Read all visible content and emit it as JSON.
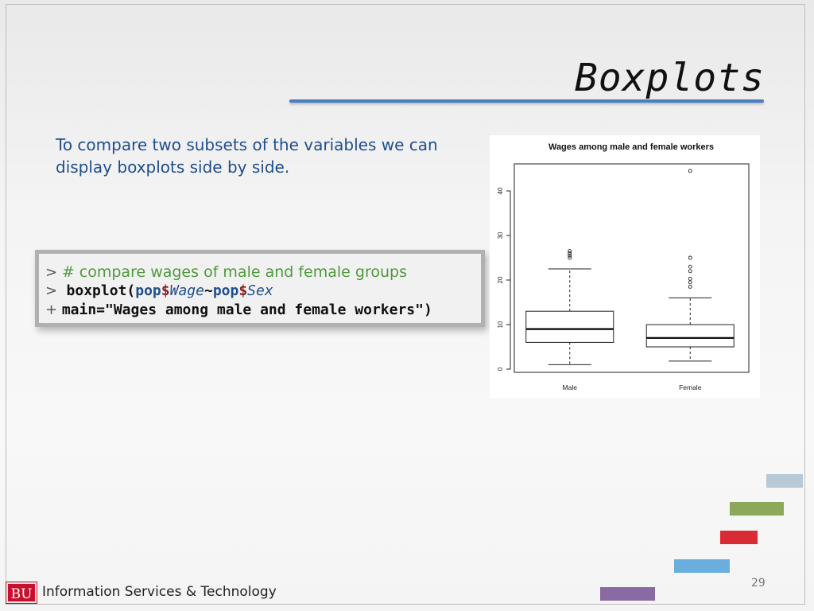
{
  "slide": {
    "title": "Boxplots",
    "intro": "To compare two subsets of the variables we can display boxplots side by side.",
    "page_number": "29"
  },
  "code": {
    "lines": [
      {
        "prompt": ">",
        "comment": "# compare wages of male and female groups"
      },
      {
        "prompt": ">",
        "func": "boxplot(",
        "obj1": "pop",
        "dollar1": "$",
        "arg1": "Wage",
        "tilde": "~",
        "obj2": "pop",
        "dollar2": "$",
        "arg2": "Sex"
      },
      {
        "prompt": "+",
        "text": "main=\"Wages among male and female workers\")"
      }
    ]
  },
  "footer": {
    "logo_text": "BU",
    "org_name": "Information Services & Technology"
  },
  "colors": {
    "title_rule": "#4a7ec2",
    "intro_text": "#1f4e8c",
    "comment": "#4f9a3c",
    "deco": [
      "#b7c9d6",
      "#8ea85a",
      "#d92b34",
      "#6aaede",
      "#8a6aa3"
    ]
  },
  "chart_data": {
    "type": "boxplot",
    "title": "Wages among male and female workers",
    "xlabel": "",
    "ylabel": "",
    "ylim": [
      0,
      46
    ],
    "yticks": [
      0,
      10,
      20,
      30,
      40
    ],
    "grid": false,
    "categories": [
      "Male",
      "Female"
    ],
    "boxes": [
      {
        "min": 1,
        "q1": 6,
        "median": 9,
        "q3": 13,
        "max": 22.5,
        "outliers": [
          25,
          25.5,
          26,
          26.5
        ]
      },
      {
        "min": 1.8,
        "q1": 5,
        "median": 7,
        "q3": 10,
        "max": 16,
        "outliers": [
          18.5,
          19.5,
          20.3,
          22,
          23,
          25,
          44.5
        ]
      }
    ]
  }
}
